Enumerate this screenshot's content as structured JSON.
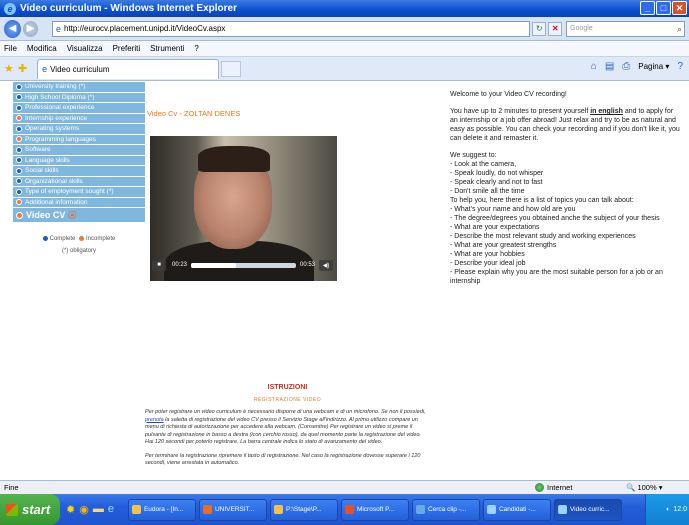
{
  "window": {
    "title": "Video curriculum - Windows Internet Explorer"
  },
  "address": {
    "url": "http://eurocv.placement.unipd.it/VideoCv.aspx",
    "search_placeholder": "Google"
  },
  "menu": [
    "File",
    "Modifica",
    "Visualizza",
    "Preferiti",
    "Strumenti",
    "?"
  ],
  "tab": {
    "label": "Video curriculum"
  },
  "tools": {
    "page": "Pagina"
  },
  "sidebar": {
    "items": [
      {
        "label": "University training (*)",
        "state": "complete"
      },
      {
        "label": "High School Diploma (*)",
        "state": "complete"
      },
      {
        "label": "Professional experience",
        "state": "complete"
      },
      {
        "label": "Internship experience",
        "state": "incomplete"
      },
      {
        "label": "Operating systems",
        "state": "complete"
      },
      {
        "label": "Programming languages",
        "state": "incomplete"
      },
      {
        "label": "Software",
        "state": "complete"
      },
      {
        "label": "Language skills",
        "state": "complete"
      },
      {
        "label": "Social skills",
        "state": "complete"
      },
      {
        "label": "Organizational skills",
        "state": "complete"
      },
      {
        "label": "Type of employment sought (*)",
        "state": "complete"
      },
      {
        "label": "Additional information",
        "state": "incomplete"
      }
    ],
    "active": "Video CV",
    "legend_complete": "Complete",
    "legend_incomplete": "Incomplete",
    "legend_obligatory": "(*) obligatory"
  },
  "main": {
    "cv_title": "Video Cv - ZOLTAN DENES",
    "video": {
      "elapsed": "00:23",
      "total": "00:53",
      "progress": 0.43
    }
  },
  "instructions": {
    "title": "ISTRUZIONI",
    "subtitle": "REGISTRAZIONE VIDEO",
    "p1_before": "Per poter registrare un video curriculum è necessario disporre di una webcam e di un microfono. Se non li possiedi, ",
    "p1_link": "prenota",
    "p1_after": " la saletta di registrazione del video CV presso il Servizio Stage all'indirizzo. Al primo utilizzo compare un menu di richiesta di autorizzazione per accedere alla webcam. (Consentire) Per registrare un video si preme il pulsante di registrazione in basso a destra (icon cerchio rosso), da quel momento parte la registrazione del video. Hai 120 secondi per poterlo registrare. La barra centrale indica lo stato di avanzamento del video.",
    "p2": "Per terminare la registrazione ripremere il tasto di registrazione. Nel caso la registrazione dovesse superare i 120 secondi, viene arrestata in automatico."
  },
  "right": {
    "welcome": "Welcome to your Video CV recording!",
    "intro_before": "You have up to 2 minutes to present yourself ",
    "intro_bold": "in english",
    "intro_after": " and to apply for an internship or a job offer abroad! Just relax and try to be as natural and easy as possible. You can check your recording and if you don't like it, you can delete it and remaster it.",
    "suggest_title": "We suggest to:",
    "suggestions": [
      "- Look at the camera,",
      "- Speak loudly, do not whisper",
      "- Speak clearly and not to fast",
      "- Don't smile all the time"
    ],
    "topics_title": "To help you, here there is a list of topics you can talk about:",
    "topics": [
      "- What's your name and how old are you",
      "- The degree/degrees you obtained anche the subject of your thesis",
      "- What are your expectations",
      "- Describe the most relevant study and working experiences",
      "- What are your greatest strengths",
      "- What are your hobbies",
      "- Describe your ideal job",
      "- Please explain why you are the most suitable person for a job or an internship"
    ]
  },
  "status": {
    "left": "Fine",
    "zone": "Internet",
    "zoom": "100%"
  },
  "taskbar": {
    "start": "start",
    "tasks": [
      "Eudora - [In...",
      "UNIVERSIT...",
      "P:\\Stage\\P...",
      "Microsoft P...",
      "Cerca clip -...",
      "Candidati -...",
      "Video curric..."
    ],
    "clock": "12.0"
  }
}
